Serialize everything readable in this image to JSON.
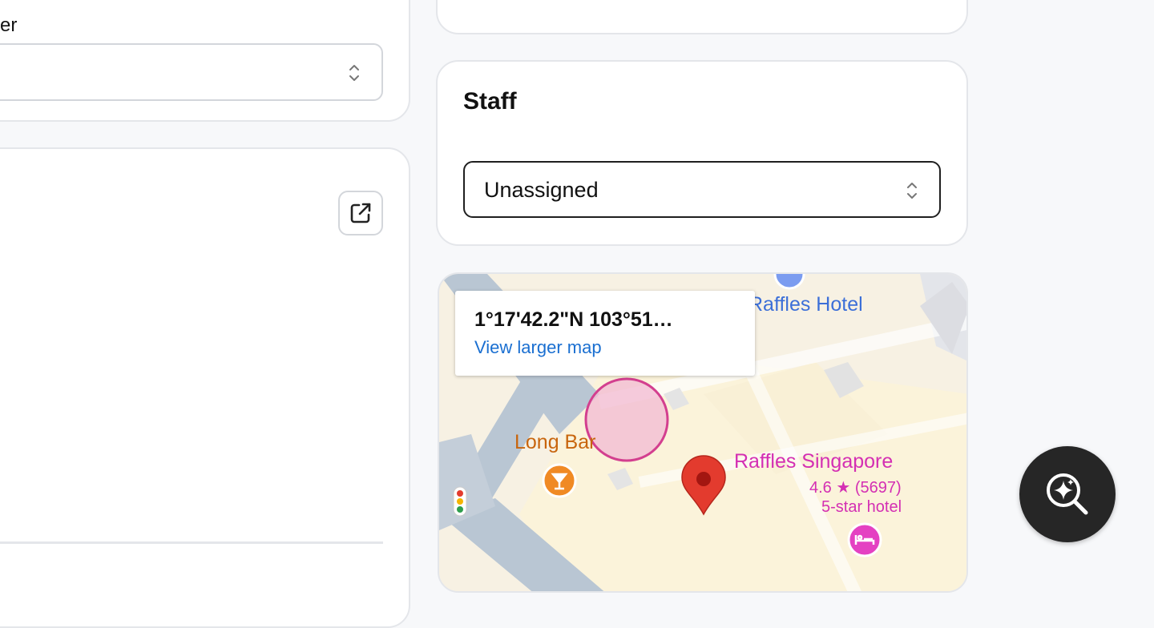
{
  "owner_field": {
    "label_fragment": "er",
    "value": ""
  },
  "staff": {
    "title": "Staff",
    "selected": "Unassigned"
  },
  "map": {
    "coordinates": "1°17'42.2\"N 103°51…",
    "view_larger_map": "View larger map",
    "places": {
      "raffles_hotel": "Raffles Hotel",
      "long_bar": "Long Bar",
      "raffles_singapore": "Raffles Singapore",
      "rating": "4.6 ★ (5697)",
      "category": "5-star hotel"
    }
  },
  "icons": {
    "external": "external-link-icon",
    "updown": "chevron-updown-icon",
    "lens": "ai-search-icon"
  },
  "colors": {
    "map_pin": "#e33b2e",
    "place_pink": "#d42fb3",
    "bar_orange": "#f08a24",
    "link_blue": "#1a6fd1"
  }
}
